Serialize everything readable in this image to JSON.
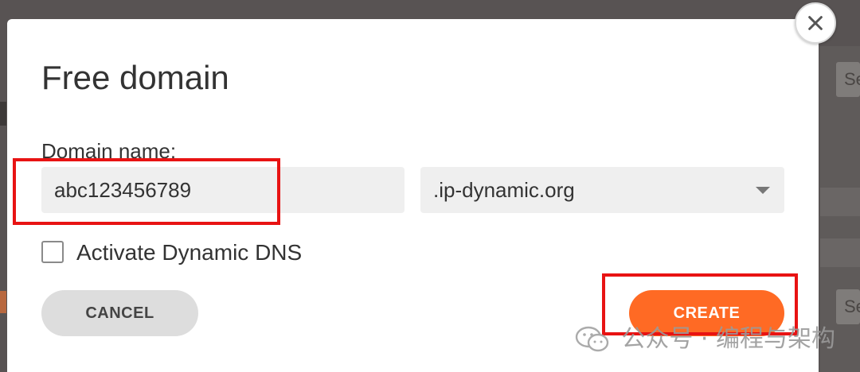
{
  "background": {
    "side_field_text_top": "Se",
    "side_field_text_bottom": "Se"
  },
  "dialog": {
    "title": "Free domain",
    "domain_label": "Domain name:",
    "domain_value": "abc123456789",
    "tld_selected": ".ip-dynamic.org",
    "checkbox_label": "Activate Dynamic DNS",
    "checkbox_checked": false,
    "cancel_label": "CANCEL",
    "create_label": "CREATE"
  },
  "icons": {
    "close": "close-icon",
    "dropdown": "chevron-down-icon",
    "watermark": "wechat-icon"
  },
  "watermark": {
    "text": "公众号 · 编程与架构"
  },
  "colors": {
    "accent": "#ff6a24",
    "highlight": "#e81313",
    "overlay": "#585353"
  }
}
